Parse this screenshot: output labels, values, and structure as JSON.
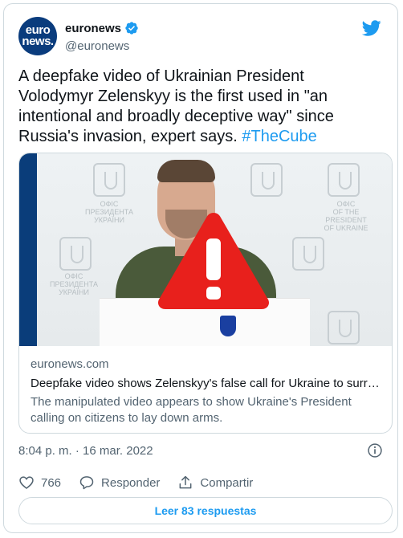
{
  "author": {
    "avatar_line1": "euro",
    "avatar_line2": "news.",
    "display_name": "euronews",
    "handle": "@euronews",
    "verified": true
  },
  "tweet": {
    "text": "A deepfake video of Ukrainian President Volodymyr Zelenskyy is the first used in \"an intentional and broadly deceptive way\" since Russia's invasion, expert says. ",
    "hashtag": "#TheCube"
  },
  "link_card": {
    "image_text": {
      "seal_caption_1": "ОФІС\nПРЕЗИДЕНТА\nУКРАЇНИ",
      "seal_caption_2": "ОФІС\nOF THE PRESIDENT\nOF UKRAINE",
      "seal_caption_3": "ОФІС\nПРЕЗИДЕНТА\nУКРАЇНИ"
    },
    "domain": "euronews.com",
    "title": "Deepfake video shows Zelenskyy's false call for Ukraine to surren...",
    "description": "The manipulated video appears to show Ukraine's President calling on citizens to lay down arms."
  },
  "timestamp": "8:04 p. m. · 16 mar. 2022",
  "actions": {
    "like_count": "766",
    "reply_label": "Responder",
    "share_label": "Compartir"
  },
  "read_replies_label": "Leer 83 respuestas",
  "colors": {
    "accent": "#1d9bf0",
    "text": "#0f1419",
    "secondary": "#536471",
    "border": "#cfd9de",
    "warning": "#e8201c"
  }
}
